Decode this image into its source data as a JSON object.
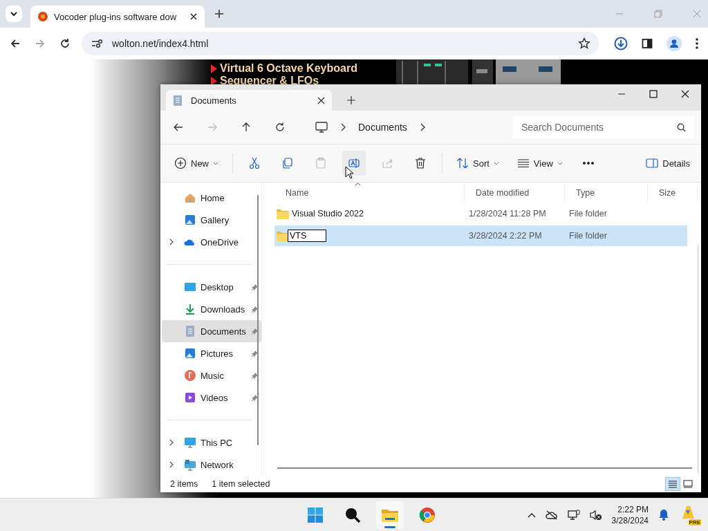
{
  "browser": {
    "tab": {
      "title": "Vocoder plug-ins software dow",
      "selected": true
    },
    "address": "wolton.net/index4.html",
    "forward_disabled": true
  },
  "web_page": {
    "links": [
      "Virtual 6 Octave Keyboard",
      "Sequencer & LFOs"
    ]
  },
  "explorer": {
    "tab": {
      "title": "Documents",
      "selected": true
    },
    "nav": {
      "forward_disabled": true
    },
    "breadcrumb": [
      "Documents"
    ],
    "search": {
      "placeholder": "Search Documents"
    },
    "toolbar": [
      [
        {
          "label": "New",
          "dropdown": true,
          "disabled": false,
          "hovered": false
        }
      ],
      [
        {
          "disabled": false,
          "hovered": false
        },
        {
          "disabled": false,
          "hovered": false
        },
        {
          "disabled": true,
          "hovered": false
        },
        {
          "disabled": false,
          "hovered": true
        },
        {
          "disabled": true,
          "hovered": false
        },
        {
          "disabled": false,
          "hovered": false
        }
      ],
      [
        {
          "label": "Sort",
          "dropdown": true,
          "disabled": false,
          "hovered": false
        },
        {
          "label": "View",
          "dropdown": true,
          "disabled": false,
          "hovered": false
        },
        {
          "disabled": false,
          "hovered": false
        }
      ]
    ],
    "details_button": "Details",
    "sidebar": [
      [
        {
          "label": "Home",
          "selected": false,
          "pinned": false,
          "expandable": false
        },
        {
          "label": "Gallery",
          "selected": false,
          "pinned": false,
          "expandable": false
        },
        {
          "label": "OneDrive",
          "selected": false,
          "pinned": false,
          "expandable": true
        }
      ],
      [
        {
          "label": "Desktop",
          "selected": false,
          "pinned": true,
          "expandable": false
        },
        {
          "label": "Downloads",
          "selected": false,
          "pinned": true,
          "expandable": false
        },
        {
          "label": "Documents",
          "selected": true,
          "pinned": true,
          "expandable": false
        },
        {
          "label": "Pictures",
          "selected": false,
          "pinned": true,
          "expandable": false
        },
        {
          "label": "Music",
          "selected": false,
          "pinned": true,
          "expandable": false
        },
        {
          "label": "Videos",
          "selected": false,
          "pinned": true,
          "expandable": false
        }
      ],
      [
        {
          "label": "This PC",
          "selected": false,
          "pinned": false,
          "expandable": true
        },
        {
          "label": "Network",
          "selected": false,
          "pinned": false,
          "expandable": true
        }
      ]
    ],
    "columns": [
      "Name",
      "Date modified",
      "Type",
      "Size"
    ],
    "rows": [
      {
        "name": "Visual Studio 2022",
        "date": "1/28/2024 11:28 PM",
        "type": "File folder",
        "selected": false,
        "editing": false
      },
      {
        "name": "VTS",
        "date": "3/28/2024 2:22 PM",
        "type": "File folder",
        "selected": true,
        "editing": true
      }
    ],
    "status": {
      "count": "2 items",
      "selection": "1 item selected"
    },
    "views": [
      {
        "selected": true
      },
      {
        "selected": false
      }
    ]
  },
  "taskbar": {
    "apps": [
      {
        "active": false
      },
      {
        "active": false
      },
      {
        "active": true
      },
      {
        "active": false
      }
    ],
    "time": "2:22 PM",
    "date": "3/28/2024",
    "badge": "PRE"
  }
}
